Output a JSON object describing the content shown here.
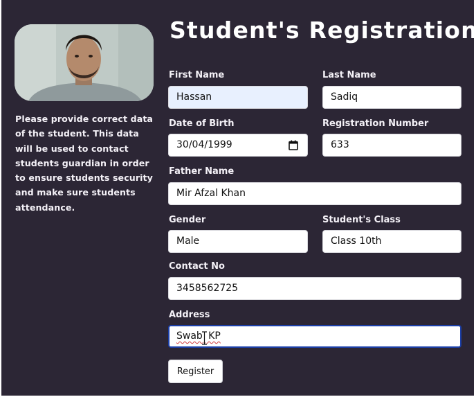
{
  "page": {
    "title": "Student's Registration",
    "note": "Please provide correct data of the student. This data will be used to contact students guardian in order to ensure students security and make sure students attendance."
  },
  "form": {
    "first_name": {
      "label": "First Name",
      "value": "Hassan"
    },
    "last_name": {
      "label": "Last Name",
      "value": "Sadiq"
    },
    "dob": {
      "label": "Date of Birth",
      "value": "30/04/1999"
    },
    "reg_no": {
      "label": "Registration Number",
      "value": "633"
    },
    "father_name": {
      "label": "Father Name",
      "value": "Mir Afzal Khan"
    },
    "gender": {
      "label": "Gender",
      "value": "Male"
    },
    "student_class": {
      "label": "Student's Class",
      "value": "Class 10th"
    },
    "contact": {
      "label": "Contact No",
      "value": "3458562725"
    },
    "address": {
      "label": "Address",
      "value": "Swabi KP"
    },
    "submit_label": "Register"
  },
  "icons": {
    "calendar": "calendar-icon",
    "cursor": "text-cursor-icon"
  },
  "colors": {
    "background": "#2c2635",
    "autofill": "#e8f0fe",
    "focus_border": "#1b3fa8",
    "spellcheck": "#d23a3a"
  }
}
